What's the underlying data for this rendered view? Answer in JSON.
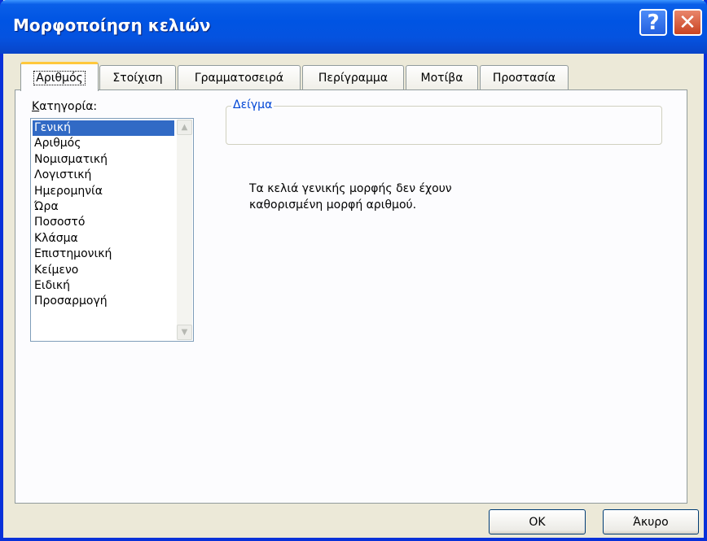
{
  "window": {
    "title": "Μορφοποίηση κελιών",
    "help_label": "?",
    "close_label": "✕"
  },
  "tabs": [
    {
      "label": "Αριθμός",
      "active": true
    },
    {
      "label": "Στοίχιση"
    },
    {
      "label": "Γραμματοσειρά"
    },
    {
      "label": "Περίγραμμα"
    },
    {
      "label": "Μοτίβα"
    },
    {
      "label": "Προστασία"
    }
  ],
  "category": {
    "label_underlined": "Κ",
    "label_rest": "ατηγορία:",
    "items": [
      "Γενική",
      "Αριθμός",
      "Νομισματική",
      "Λογιστική",
      "Ημερομηνία",
      "Ώρα",
      "Ποσοστό",
      "Κλάσμα",
      "Επιστημονική",
      "Κείμενο",
      "Ειδική",
      "Προσαρμογή"
    ],
    "selected": "Γενική"
  },
  "sample": {
    "legend": "Δείγμα",
    "value": ""
  },
  "description": {
    "line1": "Τα κελιά γενικής μορφής δεν έχουν",
    "line2": "καθορισμένη μορφή αριθμού."
  },
  "buttons": {
    "ok": "OK",
    "cancel": "Άκυρο"
  },
  "colors": {
    "titlebar": "#0054e3",
    "selection": "#316ac5",
    "active_tab_accent": "#ffc83c",
    "legend_text": "#0046d5"
  }
}
